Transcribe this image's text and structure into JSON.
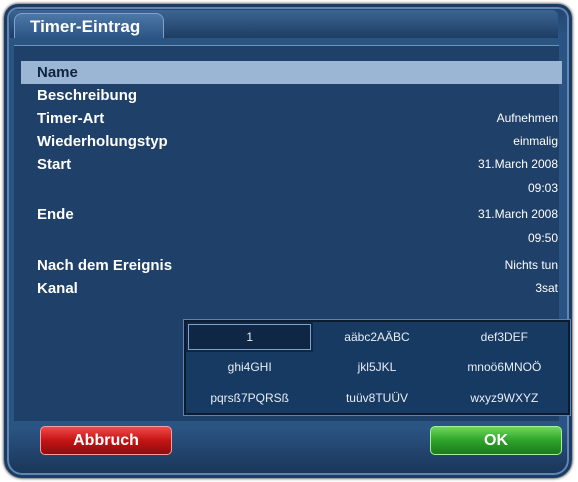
{
  "window": {
    "title": "Timer-Eintrag"
  },
  "fields": [
    {
      "label": "Name",
      "value": "",
      "selected": true
    },
    {
      "label": "Beschreibung",
      "value": ""
    },
    {
      "label": "Timer-Art",
      "value": "Aufnehmen"
    },
    {
      "label": "Wiederholungstyp",
      "value": "einmalig"
    },
    {
      "label": "Start",
      "value": "31.March 2008",
      "value2": "09:03"
    },
    {
      "label": "Ende",
      "value": "31.March 2008",
      "value2": "09:50"
    },
    {
      "label": "Nach dem Ereignis",
      "value": "Nichts tun"
    },
    {
      "label": "Kanal",
      "value": "3sat"
    }
  ],
  "keypad": {
    "keys": [
      "1",
      "aäbc2AÄBC",
      "def3DEF",
      "ghi4GHI",
      "jkl5JKL",
      "mnoö6MNOÖ",
      "pqrsß7PQRSß",
      "tuüv8TUÜV",
      "wxyz9WXYZ"
    ],
    "active_key": "1"
  },
  "buttons": {
    "cancel_label": "Abbruch",
    "ok_label": "OK"
  },
  "colors": {
    "background": "#2a5482",
    "selected_row": "#9bb6d4",
    "cancel_button": "#c41414",
    "ok_button": "#2ea32a"
  }
}
